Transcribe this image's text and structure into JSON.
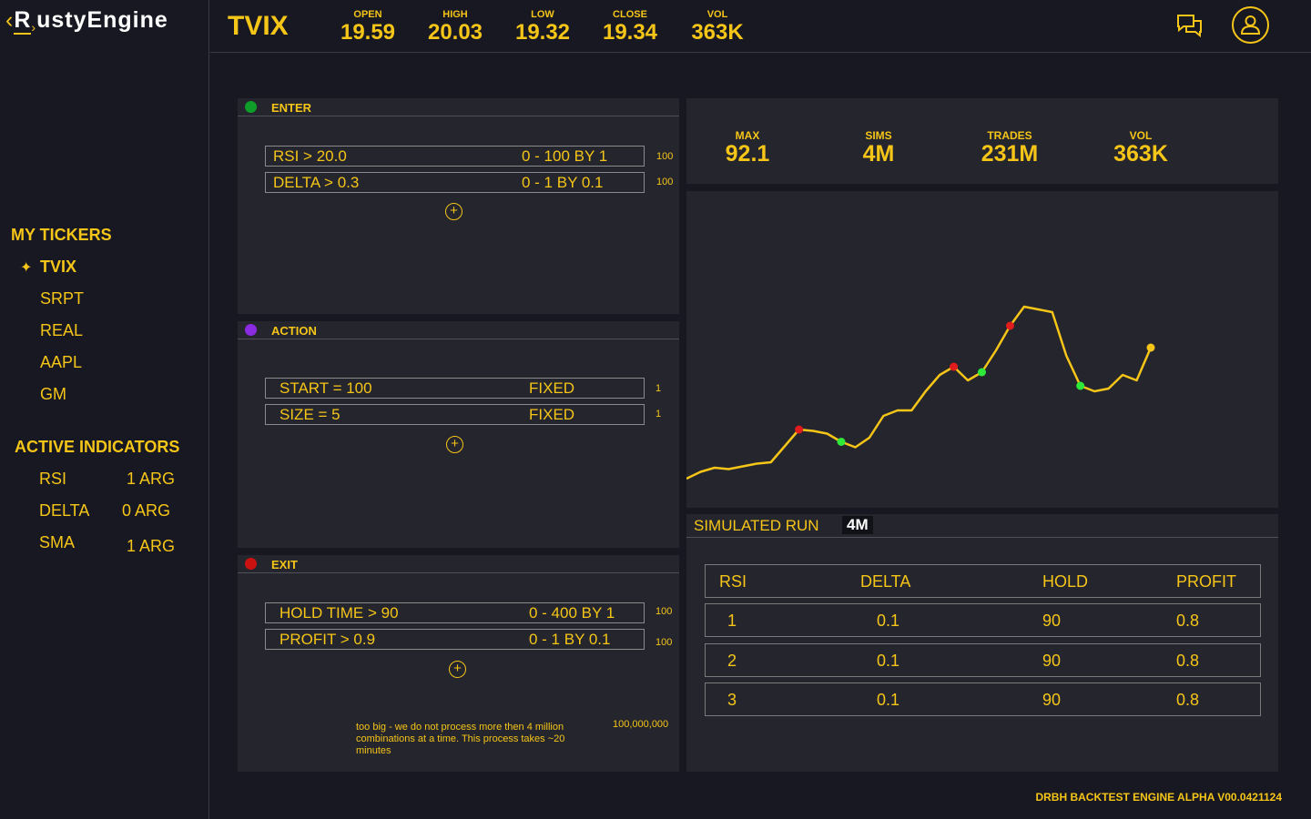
{
  "brand": {
    "logo_first": "R",
    "logo_rest": "ustyEngine"
  },
  "sidebar": {
    "tickers_title": "MY TICKERS",
    "tickers": [
      "TVIX",
      "SRPT",
      "REAL",
      "AAPL",
      "GM"
    ],
    "active_ticker_marker": "✦",
    "indicators_title": "ACTIVE INDICATORS",
    "indicators": [
      {
        "name": "RSI",
        "args": "1 ARG"
      },
      {
        "name": "DELTA",
        "args": "0 ARG"
      },
      {
        "name": "SMA",
        "args": "1 ARG"
      }
    ]
  },
  "header": {
    "ticker": "TVIX",
    "stats": [
      {
        "label": "OPEN",
        "value": "19.59"
      },
      {
        "label": "HIGH",
        "value": "20.03"
      },
      {
        "label": "LOW",
        "value": "19.32"
      },
      {
        "label": "CLOSE",
        "value": "19.34"
      },
      {
        "label": "VOL",
        "value": "363K"
      }
    ]
  },
  "enter": {
    "title": "ENTER",
    "rows": [
      {
        "condition": "RSI > 20.0",
        "range": "0 - 100 BY 1",
        "count": "100"
      },
      {
        "condition": "DELTA > 0.3",
        "range": "0 - 1 BY 0.1",
        "count": "100"
      }
    ]
  },
  "action": {
    "title": "ACTION",
    "rows": [
      {
        "condition": "START = 100",
        "range": "FIXED",
        "count": "1"
      },
      {
        "condition": "SIZE = 5",
        "range": "FIXED",
        "count": "1"
      }
    ]
  },
  "exit": {
    "title": "EXIT",
    "rows": [
      {
        "condition": "HOLD TIME > 90",
        "range": "0 - 400 BY 1",
        "count": "100"
      },
      {
        "condition": "PROFIT > 0.9",
        "range": "0 - 1 BY 0.1",
        "count": "100"
      }
    ],
    "warning": "too big - we do not process more then 4 million combinations at a time. This process takes ~20 minutes",
    "total": "100,000,000"
  },
  "summary": [
    {
      "label": "MAX",
      "value": "92.1"
    },
    {
      "label": "SIMS",
      "value": "4M"
    },
    {
      "label": "TRADES",
      "value": "231M"
    },
    {
      "label": "VOL",
      "value": "363K"
    }
  ],
  "chart_data": {
    "type": "line",
    "x": [
      0,
      1,
      2,
      3,
      4,
      5,
      6,
      7,
      8,
      9,
      10,
      11,
      12,
      13,
      14,
      15,
      16,
      17,
      18,
      19,
      20,
      21,
      22,
      23,
      24,
      25,
      26,
      27,
      28,
      29,
      30,
      31,
      32,
      33
    ],
    "values": [
      8,
      10.5,
      12,
      11.5,
      12.5,
      13.5,
      14,
      20,
      26,
      25.5,
      24.5,
      21.5,
      19.5,
      23,
      31,
      33,
      33,
      40,
      46,
      49,
      44,
      47,
      55,
      64,
      71,
      70,
      69,
      53,
      42,
      40,
      41,
      46,
      44,
      56
    ],
    "ylim": [
      0,
      100
    ],
    "line_color": "#f5c518",
    "markers": [
      {
        "index": 8,
        "color": "#e01c1c"
      },
      {
        "index": 11,
        "color": "#2ee83a"
      },
      {
        "index": 19,
        "color": "#e01c1c"
      },
      {
        "index": 21,
        "color": "#2ee83a"
      },
      {
        "index": 23,
        "color": "#e01c1c"
      },
      {
        "index": 28,
        "color": "#2ee83a"
      },
      {
        "index": 33,
        "color": "#f5c518"
      }
    ],
    "grid": false
  },
  "simulated": {
    "title": "SIMULATED RUN",
    "badge": "4M",
    "headers": [
      "RSI",
      "DELTA",
      "HOLD",
      "PROFIT"
    ],
    "rows": [
      [
        "1",
        "0.1",
        "90",
        "0.8"
      ],
      [
        "2",
        "0.1",
        "90",
        "0.8"
      ],
      [
        "3",
        "0.1",
        "90",
        "0.8"
      ]
    ]
  },
  "footer": {
    "version": "DRBH BACKTEST ENGINE ALPHA V00.0421124"
  },
  "colors": {
    "accent": "#f5c518",
    "enter": "#0f9d2a",
    "action": "#8a2be2",
    "exit": "#cc1111",
    "panel": "#25252d",
    "bg": "#181822"
  }
}
